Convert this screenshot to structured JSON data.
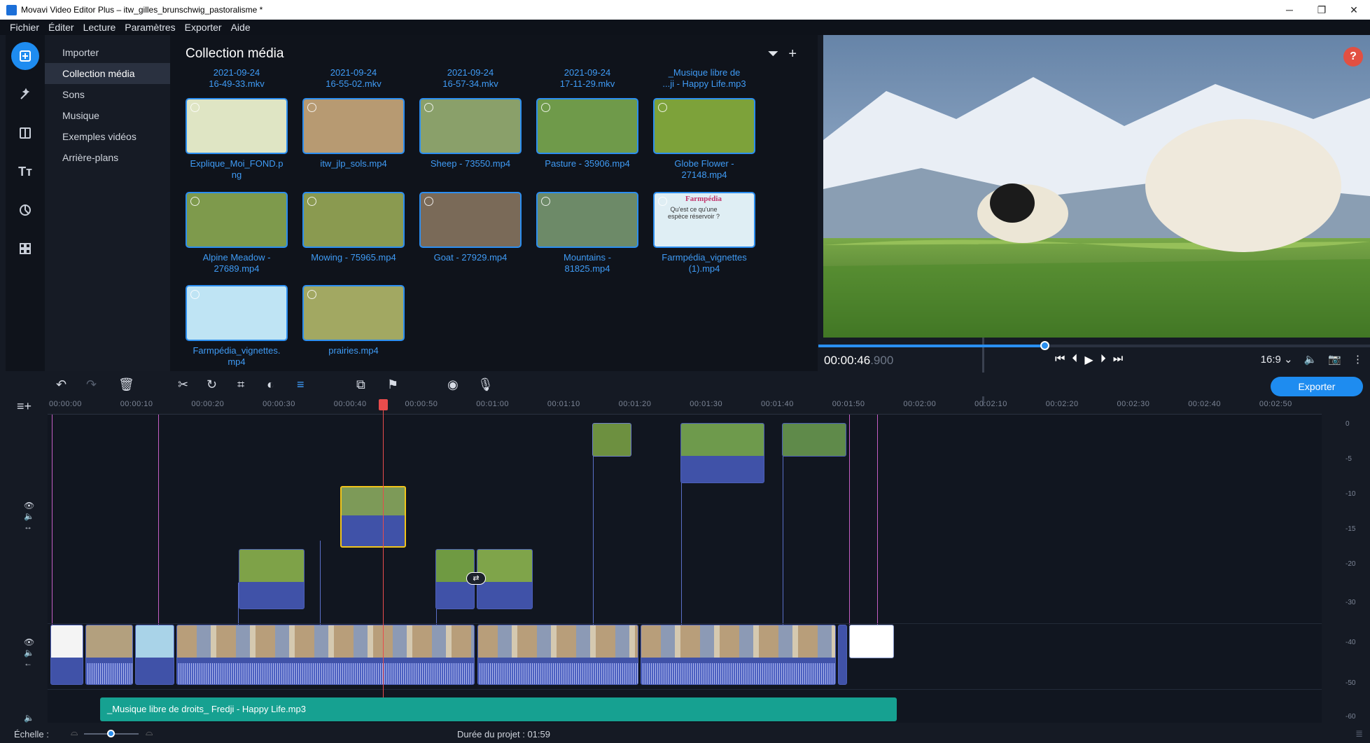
{
  "window": {
    "title": "Movavi Video Editor Plus – itw_gilles_brunschwig_pastoralisme *",
    "app_badge": "MV"
  },
  "menu": [
    "Fichier",
    "Éditer",
    "Lecture",
    "Paramètres",
    "Exporter",
    "Aide"
  ],
  "categories": [
    "Importer",
    "Collection média",
    "Sons",
    "Musique",
    "Exemples vidéos",
    "Arrière-plans"
  ],
  "media": {
    "title": "Collection média",
    "top_labels": [
      "2021-09-24\n16-49-33.mkv",
      "2021-09-24\n16-55-02.mkv",
      "2021-09-24\n16-57-34.mkv",
      "2021-09-24\n17-11-29.mkv",
      "_Musique libre de\n...ji - Happy Life.mp3"
    ],
    "items": [
      {
        "name": "Explique_Moi_FOND.p\nng",
        "color": "#dfe5c4"
      },
      {
        "name": "itw_jlp_sols.mp4",
        "color": "#b79a72"
      },
      {
        "name": "Sheep - 73550.mp4",
        "color": "#8aa06a"
      },
      {
        "name": "Pasture - 35906.mp4",
        "color": "#6f9a4a"
      },
      {
        "name": "Globe Flower -\n27148.mp4",
        "color": "#7da23a"
      },
      {
        "name": "Alpine Meadow -\n27689.mp4",
        "color": "#7e9a4c"
      },
      {
        "name": "Mowing - 75965.mp4",
        "color": "#8a9a50"
      },
      {
        "name": "Goat - 27929.mp4",
        "color": "#7a6a58"
      },
      {
        "name": "Mountains -\n81825.mp4",
        "color": "#6d8a68"
      },
      {
        "name": "Farmpédia_vignettes\n(1).mp4",
        "color": "#dfeef4",
        "logo": "Farmpédia",
        "subtitle": "Qu'est ce qu'une espèce réservoir ?"
      },
      {
        "name": "Farmpédia_vignettes.\nmp4",
        "color": "#bfe4f4"
      },
      {
        "name": "prairies.mp4",
        "color": "#a2a862"
      }
    ]
  },
  "preview": {
    "help": "?",
    "timecode": "00:00:46",
    "timecode_ms": ".900",
    "aspect": "16:9",
    "progress": 0.41
  },
  "toolbar": {
    "export": "Exporter"
  },
  "ruler": [
    "00:00:00",
    "00:00:10",
    "00:00:20",
    "00:00:30",
    "00:00:40",
    "00:00:50",
    "00:01:00",
    "00:01:10",
    "00:01:20",
    "00:01:30",
    "00:01:40",
    "00:01:50",
    "00:02:00",
    "00:02:10",
    "00:02:20",
    "00:02:30",
    "00:02:40",
    "00:02:50"
  ],
  "meter": [
    "0",
    "-5",
    "-10",
    "-15",
    "-20",
    "-30",
    "-40",
    "-50",
    "-60"
  ],
  "audio": {
    "track": "_Musique libre de droits_ Fredji - Happy Life.mp3"
  },
  "status": {
    "scale_label": "Échelle :",
    "duration": "Durée du projet : 01:59",
    "scale": 0.5
  }
}
